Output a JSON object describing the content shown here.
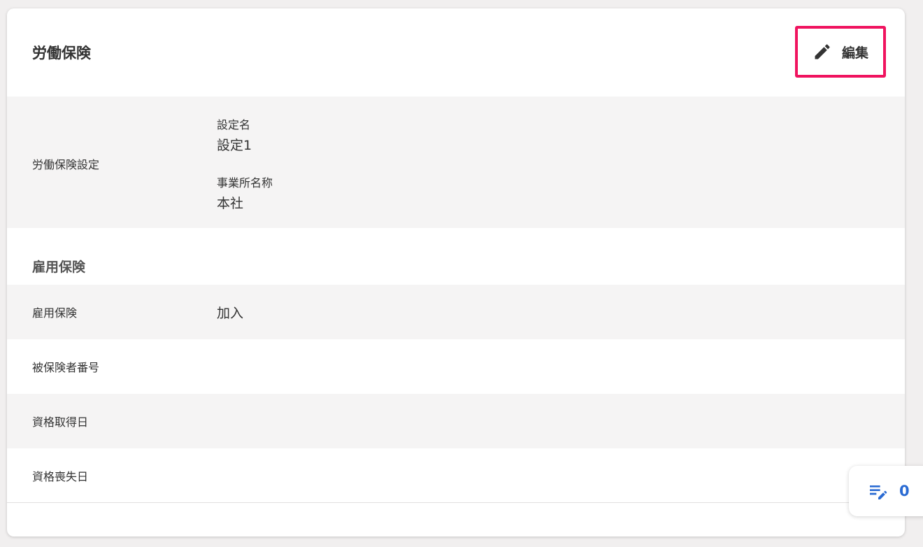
{
  "card": {
    "title": "労働保険",
    "edit_label": "編集",
    "edit_icon": "pencil-icon"
  },
  "insurance_setting": {
    "label": "労働保険設定",
    "setting_name_label": "設定名",
    "setting_name_value": "設定1",
    "office_name_label": "事業所名称",
    "office_name_value": "本社"
  },
  "employment_insurance": {
    "section_title": "雇用保険",
    "rows": [
      {
        "label": "雇用保険",
        "value": "加入"
      },
      {
        "label": "被保険者番号",
        "value": ""
      },
      {
        "label": "資格取得日",
        "value": ""
      },
      {
        "label": "資格喪失日",
        "value": ""
      }
    ]
  },
  "notes_fab": {
    "icon": "edit-notes-icon",
    "count": "0"
  },
  "colors": {
    "highlight_border": "#f0135f",
    "fab_accent": "#2a6bd3",
    "row_gray": "#f5f4f4"
  }
}
